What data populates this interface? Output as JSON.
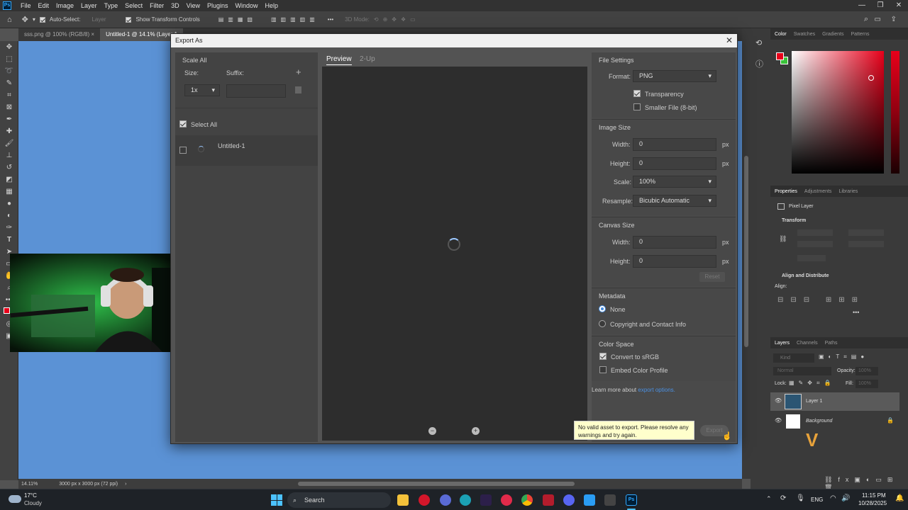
{
  "menubar": {
    "items": [
      "File",
      "Edit",
      "Image",
      "Layer",
      "Type",
      "Select",
      "Filter",
      "3D",
      "View",
      "Plugins",
      "Window",
      "Help"
    ],
    "app_icon": "Ps"
  },
  "options_bar": {
    "auto_select_label": "Auto-Select:",
    "auto_select_target": "Layer",
    "show_transform_label": "Show Transform Controls",
    "mode_3d_label": "3D Mode:"
  },
  "doc_tabs": [
    "sss.png @ 100% (RGB/8)",
    "Untitled-1 @ 14.1% (Layer 1"
  ],
  "status": {
    "zoom": "14.11%",
    "doc_size": "3000 px x 3000 px (72 ppi)"
  },
  "dialog": {
    "title": "Export As",
    "left": {
      "scale_all": "Scale All",
      "size_label": "Size:",
      "suffix_label": "Suffix:",
      "size_value": "1x",
      "select_all": "Select All",
      "item_name": "Untitled-1"
    },
    "preview_tabs": [
      "Preview",
      "2-Up"
    ],
    "file_settings": {
      "heading": "File Settings",
      "format_label": "Format:",
      "format_value": "PNG",
      "transparency": "Transparency",
      "smaller_file": "Smaller File (8-bit)"
    },
    "image_size": {
      "heading": "Image Size",
      "width_label": "Width:",
      "width_value": "0",
      "height_label": "Height:",
      "height_value": "0",
      "scale_label": "Scale:",
      "scale_value": "100%",
      "resample_label": "Resample:",
      "resample_value": "Bicubic Automatic",
      "unit": "px"
    },
    "canvas_size": {
      "heading": "Canvas Size",
      "width_label": "Width:",
      "width_value": "0",
      "height_label": "Height:",
      "height_value": "0",
      "unit": "px",
      "reset": "Reset"
    },
    "metadata": {
      "heading": "Metadata",
      "none": "None",
      "copyright": "Copyright and Contact Info"
    },
    "color_space": {
      "heading": "Color Space",
      "convert": "Convert to sRGB",
      "embed": "Embed Color Profile"
    },
    "learn_more": "Learn more about",
    "export_options_link": "export options.",
    "tooltip": "No valid asset to export. Please resolve any warnings and try again.",
    "export_button": "Export"
  },
  "right_panels": {
    "color_tabs": [
      "Color",
      "Swatches",
      "Gradients",
      "Patterns"
    ],
    "props_tabs": [
      "Properties",
      "Adjustments",
      "Libraries"
    ],
    "pixel_layer": "Pixel Layer",
    "transform": "Transform",
    "align": "Align and Distribute",
    "align_sub": "Align:",
    "layers_tabs": [
      "Layers",
      "Channels",
      "Paths"
    ],
    "kind": "Kind",
    "blend": "Normal",
    "opacity_label": "Opacity:",
    "opacity_value": "100%",
    "lock_label": "Lock:",
    "fill_label": "Fill:",
    "fill_value": "100%",
    "layers": [
      "Layer 1",
      "Background"
    ]
  },
  "taskbar": {
    "weather_temp": "17°C",
    "weather_desc": "Cloudy",
    "search": "Search",
    "lang": "ENG",
    "time": "11:15 PM",
    "date": "10/28/2025"
  },
  "colors": {
    "canvas_blue": "#5b92d5",
    "accent": "#4a90e2",
    "foreground": "#e8001a",
    "background": "#3ac33a"
  }
}
